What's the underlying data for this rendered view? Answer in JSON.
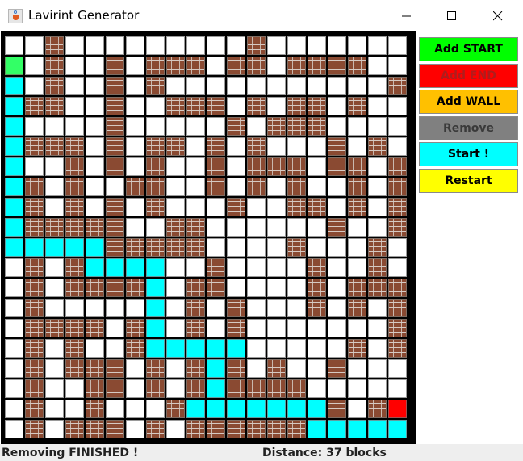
{
  "window": {
    "title": "Lavirint Generator"
  },
  "controls": {
    "add_start": "Add START",
    "add_end": "Add END",
    "add_wall": "Add WALL",
    "remove": "Remove",
    "start": "Start !",
    "restart": "Restart"
  },
  "colors": {
    "add_start_bg": "#00ff00",
    "add_end_bg": "#ff0000",
    "add_wall_bg": "#ffc000",
    "remove_bg": "#808080",
    "start_bg": "#00ffff",
    "restart_bg": "#ffff00",
    "add_end_text": "#b01c1c",
    "remove_text": "#3a3a3a"
  },
  "status": {
    "message": "Removing FINISHED !",
    "distance": "Distance: 37 blocks"
  },
  "maze": {
    "rows": 20,
    "cols": 20,
    "legend": {
      ".": "empty",
      "W": "wall",
      "P": "path",
      "S": "start",
      "E": "end"
    },
    "grid": [
      "..W.........W.......",
      "S.W..W.WWW.WW.WWWW..",
      "P.W..W.W...........WW",
      "PWW..W..WWW.W.WW.W..",
      "P....W.....W.WWW....",
      "PWWW.W.WW.W.W...W.W",
      "P..W.W.W..W.WWW.WW.W",
      "PW.W..WW..W.W.W..W.W",
      "PW.W.W.W...W..WW.W.W",
      "PWWWWW..WW......W..W",
      "PPPPPWWWWW....W...W.",
      ".W.WPPPP..W....W..W.",
      ".W.WWWWP.WW....W.WWW",
      ".W.....P.W.W...W.W.W",
      ".WWWW.WP.W.W.......W",
      ".W.W..WPPPPP.....W.WW",
      ".W.WWW.W.WPW.W..W...",
      ".W..WW.W.WPWWWW.....",
      ".W..W...WPPPPPPPW.WE",
      ".W.WWW.W.WWWWWWPPPPP"
    ]
  }
}
